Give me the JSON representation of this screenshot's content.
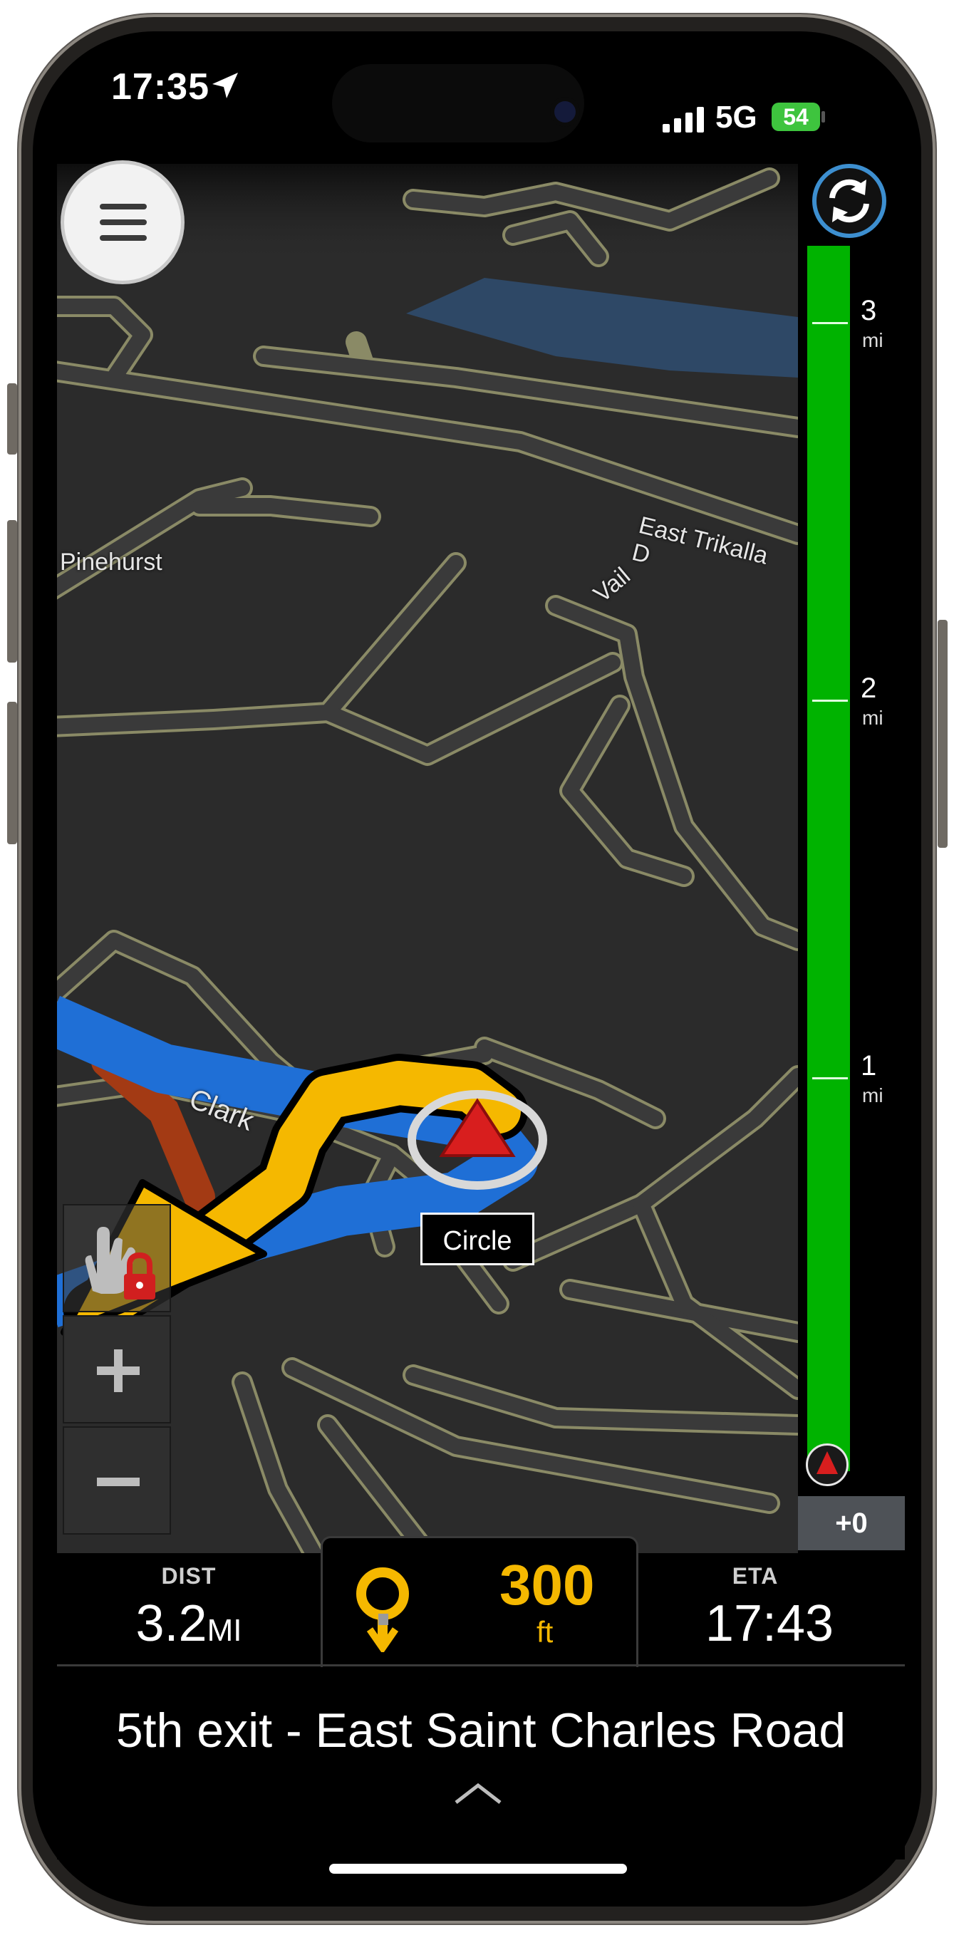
{
  "status_bar": {
    "time": "17:35",
    "network": "5G",
    "battery": "54"
  },
  "map": {
    "street_labels": [
      "East Trikalla D",
      "Pinehurst",
      "Vail",
      "Clark"
    ],
    "current_location_label": "Circle",
    "colors": {
      "route": "#1f6fd6",
      "maneuver_arrow": "#f5b800",
      "background": "#2b2b2b"
    }
  },
  "route_progress": {
    "miles": [
      {
        "value": "3",
        "unit": "mi"
      },
      {
        "value": "2",
        "unit": "mi"
      },
      {
        "value": "1",
        "unit": "mi"
      }
    ],
    "offset": "+0",
    "bar_color": "#00b300"
  },
  "trip": {
    "dist_label": "DIST",
    "dist_value": "3.2",
    "dist_unit": "MI",
    "eta_label": "ETA",
    "eta_value": "17:43"
  },
  "next_turn": {
    "distance": "300",
    "unit": "ft",
    "icon": "roundabout-exit-icon"
  },
  "instruction": "5th exit - East Saint Charles Road"
}
